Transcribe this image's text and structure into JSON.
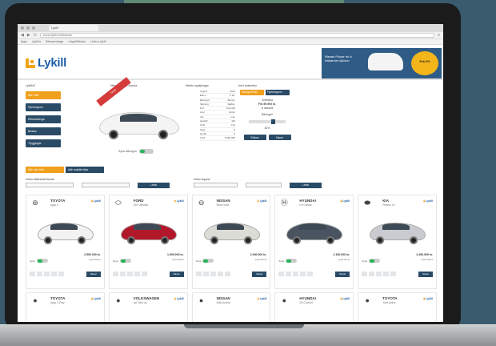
{
  "browser": {
    "tab_title": "Lykill",
    "url": "www.lykill.is/bilasala",
    "bookmarks": [
      "Apps",
      "Lykill.is",
      "Bílasamningar",
      "Leiga/Rekstur",
      "Leita á Lykill"
    ]
  },
  "header": {
    "logo_text": "Lykill",
    "banner": {
      "text": "Nissan Pulsar nú á frábærum kjörum",
      "badge": "Frá 0%"
    }
  },
  "top": {
    "col_heads": [
      "Lykilbíll",
      "Nissan Pulsar Acenta",
      "Helstu upplýsingar",
      "Þinn kostnaður"
    ],
    "side_nav": [
      "Allir bílar",
      "Fjármögnun",
      "Rekstrarleiga",
      "Bílalán",
      "Tryggingar"
    ],
    "ribbon": "Tilboð",
    "toggle_label": "Sýna afborgun",
    "specs": [
      [
        "Árgerð",
        "2016"
      ],
      [
        "Ekinn",
        "0 km"
      ],
      [
        "Eldsneyti",
        "Bensín"
      ],
      [
        "Skipting",
        "Sjálfsk."
      ],
      [
        "Drif",
        "Framdrif"
      ],
      [
        "Litur",
        "Hvítur"
      ],
      [
        "Vél",
        "1.2L"
      ],
      [
        "Hestöfl",
        "115"
      ],
      [
        "CO2",
        "124"
      ],
      [
        "Sæti",
        "5"
      ],
      [
        "Hurðir",
        "5"
      ],
      [
        "Verð",
        "3.590.000"
      ]
    ],
    "price_tabs": [
      "Staðgreiðsla",
      "Fjármögnun"
    ],
    "price_lines": [
      "Greiðslur",
      "Frá 59.900 kr.",
      "á mánuði",
      "Útborgun",
      "32%",
      "Lánstími",
      "84 mán"
    ],
    "price_buttons": [
      "Reikna",
      "Nánar"
    ]
  },
  "listing": {
    "tabs": [
      "Allir nýir bílar",
      "Allir notaðir bílar"
    ],
    "filter_labels": [
      "Veldu bílaframleiðanda",
      "Veldu tegund",
      "Veldu útlit"
    ],
    "filter_button": "Leita",
    "cards": [
      {
        "brand": "TOYOTA",
        "model": "Aygo X",
        "logo": "toyota-logo",
        "price": "2.590.000 kr.",
        "sub": "Lykill tilboð",
        "color": "#f2f2f2"
      },
      {
        "brand": "FORD",
        "model": "Ka+ Ultimate",
        "logo": "ford-logo",
        "price": "1.990.000 kr.",
        "sub": "Lykill tilboð",
        "color": "#b3172a"
      },
      {
        "brand": "NISSAN",
        "model": "Micra Visia",
        "logo": "nissan-logo",
        "price": "2.290.000 kr.",
        "sub": "Lykill tilboð",
        "color": "#dcdcd6"
      },
      {
        "brand": "HYUNDAI",
        "model": "i10 Classic",
        "logo": "hyundai-logo",
        "price": "2.190.000 kr.",
        "sub": "Lykill tilboð",
        "color": "#4a5460"
      },
      {
        "brand": "KIA",
        "model": "Picanto LX",
        "logo": "kia-logo",
        "price": "2.450.000 kr.",
        "sub": "Lykill tilboð",
        "color": "#c9cbd0"
      }
    ],
    "cards_row2": [
      {
        "brand": "TOYOTA",
        "model": "Aygo X-Play"
      },
      {
        "brand": "VOLKSWAGEN",
        "model": "up! Take Up"
      },
      {
        "brand": "NISSAN",
        "model": "Note Acenta"
      },
      {
        "brand": "HYUNDAI",
        "model": "i20 Comfort"
      },
      {
        "brand": "TOYOTA",
        "model": "Yaris Active"
      }
    ],
    "more_button": "Nánar",
    "toggle_label": "Sýna"
  }
}
